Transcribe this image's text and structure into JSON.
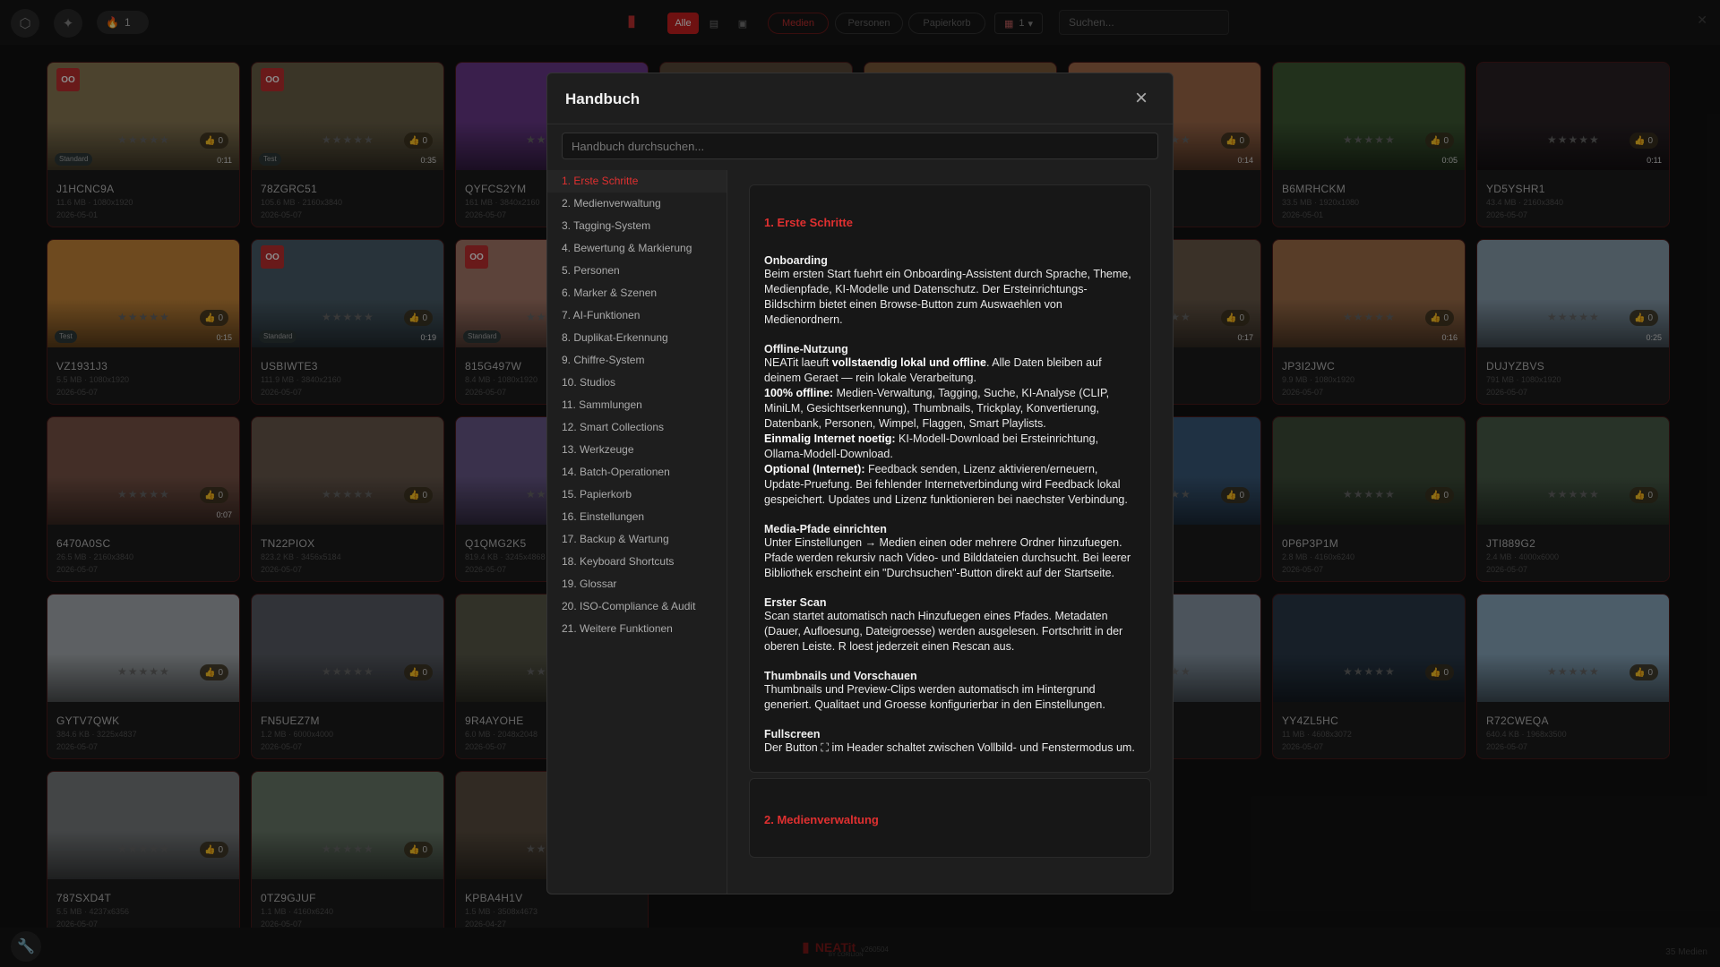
{
  "topbar": {
    "fire_count": "1",
    "filter_all": "Alle",
    "filter_media": "Medien",
    "filter_persons": "Personen",
    "filter_trash": "Papierkorb",
    "calendar_value": "1",
    "search_placeholder": "Suchen..."
  },
  "cards": [
    {
      "name": "J1HCNC9A",
      "meta": "11.6 MB · 1080x1920",
      "date": "2026-05-01",
      "duration": "0:11",
      "tag": "Standard",
      "likes": "0",
      "bg": "#8a7a55",
      "oo": true
    },
    {
      "name": "78ZGRC51",
      "meta": "105.6 MB · 2160x3840",
      "date": "2026-05-07",
      "duration": "0:35",
      "tag": "Test",
      "likes": "0",
      "bg": "#6b6148",
      "oo": true
    },
    {
      "name": "QYFCS2YM",
      "meta": "161 MB · 3840x2160",
      "date": "2026-05-07",
      "duration": "",
      "tag": "",
      "likes": "0",
      "bg": "#6a3a8a",
      "oo": false
    },
    {
      "name": "",
      "meta": "",
      "date": "",
      "duration": "",
      "tag": "",
      "likes": "0",
      "bg": "#5a4a3a",
      "oo": false
    },
    {
      "name": "",
      "meta": "",
      "date": "",
      "duration": "",
      "tag": "",
      "likes": "0",
      "bg": "#7a5a3a",
      "oo": false
    },
    {
      "name": "",
      "meta": "",
      "date": "",
      "duration": "0:14",
      "tag": "",
      "likes": "0",
      "bg": "#a06a4a",
      "oo": false
    },
    {
      "name": "B6MRHCKM",
      "meta": "33.5 MB · 1920x1080",
      "date": "2026-05-01",
      "duration": "0:05",
      "tag": "",
      "likes": "0",
      "bg": "#3e5a34",
      "oo": false
    },
    {
      "name": "YD5YSHR1",
      "meta": "43.4 MB · 2160x3840",
      "date": "2026-05-07",
      "duration": "0:11",
      "tag": "",
      "likes": "0",
      "bg": "#2a2226",
      "oo": false
    },
    {
      "name": "VZ1931J3",
      "meta": "5.5 MB · 1080x1920",
      "date": "2026-05-07",
      "duration": "0:15",
      "tag": "Test",
      "likes": "0",
      "bg": "#c8883a",
      "oo": false
    },
    {
      "name": "USBIWTE3",
      "meta": "111.9 MB · 3840x2160",
      "date": "2026-05-07",
      "duration": "0:19",
      "tag": "Standard",
      "likes": "0",
      "bg": "#4a5e6a",
      "oo": true
    },
    {
      "name": "815G497W",
      "meta": "8.4 MB · 1080x1920",
      "date": "2026-05-07",
      "duration": "",
      "tag": "Standard",
      "likes": "0",
      "bg": "#a87a6a",
      "oo": true
    },
    {
      "name": "",
      "meta": "",
      "date": "",
      "duration": "",
      "tag": "",
      "likes": "0",
      "bg": "#3a3a3a",
      "oo": false
    },
    {
      "name": "",
      "meta": "",
      "date": "",
      "duration": "",
      "tag": "",
      "likes": "0",
      "bg": "#3a3a3a",
      "oo": false
    },
    {
      "name": "",
      "meta": "",
      "date": "",
      "duration": "0:17",
      "tag": "",
      "likes": "0",
      "bg": "#6a5a4a",
      "oo": false
    },
    {
      "name": "JP3I2JWC",
      "meta": "9.9 MB · 1080x1920",
      "date": "2026-05-07",
      "duration": "0:16",
      "tag": "",
      "likes": "0",
      "bg": "#a0704a",
      "oo": false
    },
    {
      "name": "DUJYZBVS",
      "meta": "791 MB · 1080x1920",
      "date": "2026-05-07",
      "duration": "0:25",
      "tag": "",
      "likes": "0",
      "bg": "#8aa0b0",
      "oo": false
    },
    {
      "name": "6470A0SC",
      "meta": "26.5 MB · 2160x3840",
      "date": "2026-05-07",
      "duration": "0:07",
      "tag": "",
      "likes": "0",
      "bg": "#7a5548",
      "oo": false
    },
    {
      "name": "TN22PIOX",
      "meta": "823.2 KB · 3456x5184",
      "date": "2026-05-07",
      "duration": "",
      "tag": "",
      "likes": "0",
      "bg": "#6a5a4e",
      "oo": false
    },
    {
      "name": "Q1QMG2K5",
      "meta": "819.4 KB · 3245x4868",
      "date": "2026-05-07",
      "duration": "",
      "tag": "",
      "likes": "0",
      "bg": "#6a5a8a",
      "oo": false
    },
    {
      "name": "",
      "meta": "",
      "date": "",
      "duration": "",
      "tag": "",
      "likes": "0",
      "bg": "#3a3a3a",
      "oo": false
    },
    {
      "name": "",
      "meta": "",
      "date": "",
      "duration": "",
      "tag": "",
      "likes": "0",
      "bg": "#3a3a3a",
      "oo": false
    },
    {
      "name": "",
      "meta": "",
      "date": "",
      "duration": "",
      "tag": "",
      "likes": "0",
      "bg": "#3a5a7a",
      "oo": false
    },
    {
      "name": "0P6P3P1M",
      "meta": "2.8 MB · 4160x6240",
      "date": "2026-05-07",
      "duration": "",
      "tag": "",
      "likes": "0",
      "bg": "#3e4e3a",
      "oo": false
    },
    {
      "name": "JTI889G2",
      "meta": "2.4 MB · 4000x6000",
      "date": "2026-05-07",
      "duration": "",
      "tag": "",
      "likes": "0",
      "bg": "#4a5e4a",
      "oo": false
    },
    {
      "name": "GYTV7QWK",
      "meta": "384.6 KB · 3225x4837",
      "date": "2026-05-07",
      "duration": "",
      "tag": "",
      "likes": "0",
      "bg": "#aab0b4",
      "oo": false
    },
    {
      "name": "FN5UEZ7M",
      "meta": "1.2 MB · 6000x4000",
      "date": "2026-05-07",
      "duration": "",
      "tag": "",
      "likes": "0",
      "bg": "#5a5e66",
      "oo": false
    },
    {
      "name": "9R4AYOHE",
      "meta": "6.0 MB · 2048x2048",
      "date": "2026-05-07",
      "duration": "",
      "tag": "",
      "likes": "0",
      "bg": "#5a5a4a",
      "oo": false
    },
    {
      "name": "",
      "meta": "",
      "date": "",
      "duration": "",
      "tag": "",
      "likes": "0",
      "bg": "#3a3a3a",
      "oo": false
    },
    {
      "name": "",
      "meta": "",
      "date": "",
      "duration": "",
      "tag": "",
      "likes": "0",
      "bg": "#3a3a3a",
      "oo": false
    },
    {
      "name": "",
      "meta": "",
      "date": "",
      "duration": "",
      "tag": "",
      "likes": "",
      "bg": "#8a9aa8",
      "oo": false
    },
    {
      "name": "YY4ZL5HC",
      "meta": "11 MB · 4608x3072",
      "date": "2026-05-07",
      "duration": "",
      "tag": "",
      "likes": "0",
      "bg": "#2a3a4a",
      "oo": false
    },
    {
      "name": "R72CWEQA",
      "meta": "640.4 KB · 1968x3500",
      "date": "2026-05-07",
      "duration": "",
      "tag": "",
      "likes": "0",
      "bg": "#8aaac0",
      "oo": false
    },
    {
      "name": "787SXD4T",
      "meta": "5.5 MB · 4237x6356",
      "date": "2026-05-07",
      "duration": "",
      "tag": "",
      "likes": "0",
      "bg": "#7a7e80",
      "oo": false
    },
    {
      "name": "0TZ9GJUF",
      "meta": "1.1 MB · 4160x6240",
      "date": "2026-05-07",
      "duration": "",
      "tag": "",
      "likes": "0",
      "bg": "#6a7a6a",
      "oo": false
    },
    {
      "name": "KPBA4H1V",
      "meta": "1.5 MB · 3508x4673",
      "date": "2026-04-27",
      "duration": "",
      "tag": "",
      "likes": "",
      "bg": "#5a4e40",
      "oo": false
    }
  ],
  "modal": {
    "title": "Handbuch",
    "search_placeholder": "Handbuch durchsuchen...",
    "toc": [
      "1. Erste Schritte",
      "2. Medienverwaltung",
      "3. Tagging-System",
      "4. Bewertung & Markierung",
      "5. Personen",
      "6. Marker & Szenen",
      "7. AI-Funktionen",
      "8. Duplikat-Erkennung",
      "9. Chiffre-System",
      "10. Studios",
      "11. Sammlungen",
      "12. Smart Collections",
      "13. Werkzeuge",
      "14. Batch-Operationen",
      "15. Papierkorb",
      "16. Einstellungen",
      "17. Backup & Wartung",
      "18. Keyboard Shortcuts",
      "19. Glossar",
      "20. ISO-Compliance & Audit",
      "21. Weitere Funktionen"
    ],
    "section1_title": "1. Erste Schritte",
    "onboarding_title": "Onboarding",
    "onboarding_text": "Beim ersten Start fuehrt ein Onboarding-Assistent durch Sprache, Theme, Medienpfade, KI-Modelle und Datenschutz. Der Ersteinrichtungs-Bildschirm bietet einen Browse-Button zum Auswaehlen von Medienordnern.",
    "offline_title": "Offline-Nutzung",
    "offline_p1_pre": "NEATit laeuft ",
    "offline_p1_bold": "vollstaendig lokal und offline",
    "offline_p1_post": ". Alle Daten bleiben auf deinem Geraet — rein lokale Verarbeitung.",
    "offline_l1_bold": "100% offline:",
    "offline_l1_text": " Medien-Verwaltung, Tagging, Suche, KI-Analyse (CLIP, MiniLM, Gesichtserkennung), Thumbnails, Trickplay, Konvertierung, Datenbank, Personen, Wimpel, Flaggen, Smart Playlists.",
    "offline_l2_bold": "Einmalig Internet noetig:",
    "offline_l2_text": " KI-Modell-Download bei Ersteinrichtung, Ollama-Modell-Download.",
    "offline_l3_bold": "Optional (Internet):",
    "offline_l3_text": " Feedback senden, Lizenz aktivieren/erneuern, Update-Pruefung. Bei fehlender Internetverbindung wird Feedback lokal gespeichert. Updates und Lizenz funktionieren bei naechster Verbindung.",
    "paths_title": "Media-Pfade einrichten",
    "paths_text": "Unter Einstellungen → Medien einen oder mehrere Ordner hinzufuegen. Pfade werden rekursiv nach Video- und Bilddateien durchsucht. Bei leerer Bibliothek erscheint ein \"Durchsuchen\"-Button direkt auf der Startseite.",
    "scan_title": "Erster Scan",
    "scan_text": "Scan startet automatisch nach Hinzufuegen eines Pfades. Metadaten (Dauer, Aufloesung, Dateigroesse) werden ausgelesen. Fortschritt in der oberen Leiste. R loest jederzeit einen Rescan aus.",
    "thumbs_title": "Thumbnails und Vorschauen",
    "thumbs_text": "Thumbnails und Preview-Clips werden automatisch im Hintergrund generiert. Qualitaet und Groesse konfigurierbar in den Einstellungen.",
    "fullscreen_title": "Fullscreen",
    "fullscreen_text": "Der Button ⛶ im Header schaltet zwischen Vollbild- und Fenstermodus um.",
    "section2_title": "2. Medienverwaltung"
  },
  "footer": {
    "brand": "NEATit",
    "version": "v260504",
    "sub": "BY CORILION",
    "count": "35 Medien"
  },
  "colors": {
    "accent": "#e03030",
    "bg": "#121212"
  }
}
